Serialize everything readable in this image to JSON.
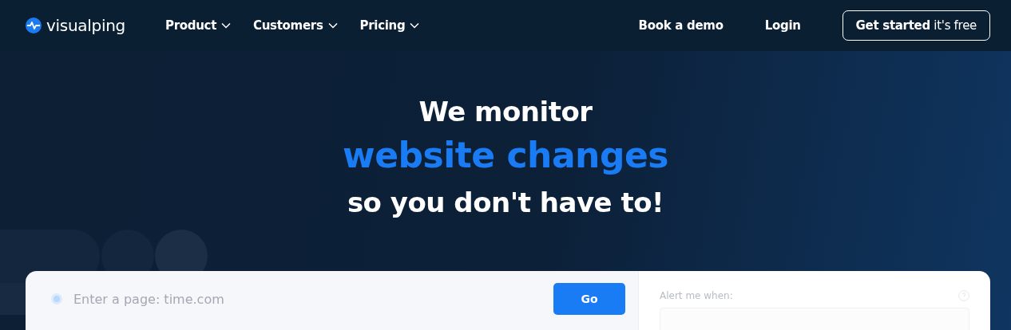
{
  "header": {
    "logo": "visualping",
    "nav": [
      {
        "label": "Product",
        "dropdown": true
      },
      {
        "label": "Customers",
        "dropdown": true
      },
      {
        "label": "Pricing",
        "dropdown": true
      }
    ],
    "links": [
      "Book a demo",
      "Login"
    ],
    "cta": "**Get started** it's free"
  },
  "hero": {
    "line_1": "We monitor",
    "highlight": "website changes",
    "line_3": "so you don't have to!"
  },
  "monitor_form": {
    "url_field": {
      "placeholder": "Enter a page: time.com"
    },
    "go_button": "Go",
    "alert_label": "Alert me when:"
  }
}
